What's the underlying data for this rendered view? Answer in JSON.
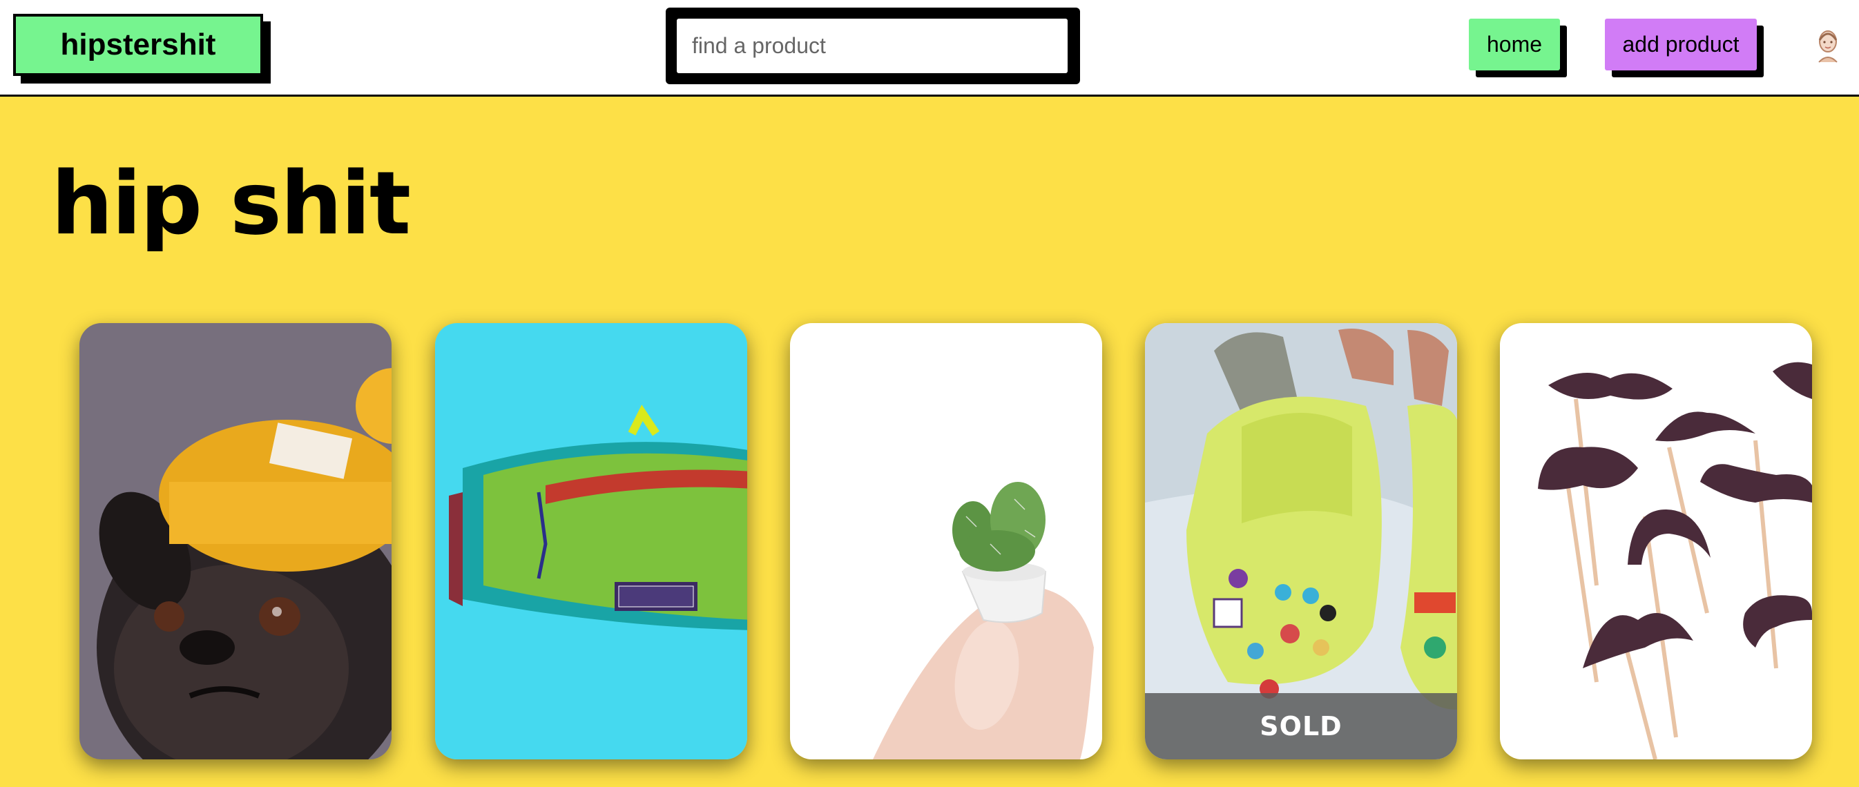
{
  "header": {
    "logo_text": "hipstershit",
    "search": {
      "placeholder": "find a product",
      "value": ""
    },
    "nav": {
      "home_label": "home",
      "add_product_label": "add product"
    },
    "avatar_icon": "user-avatar-icon"
  },
  "main": {
    "title": "hip shit",
    "products": [
      {
        "image": "pug-in-beanie",
        "sold": false
      },
      {
        "image": "patagonia-fanny-pack",
        "sold": false
      },
      {
        "image": "mini-cactus",
        "sold": false
      },
      {
        "image": "crocs-with-charms",
        "sold": true,
        "badge": "SOLD"
      },
      {
        "image": "mustache-props",
        "sold": false
      }
    ]
  },
  "colors": {
    "background": "#fde047",
    "logo_bg": "#76f48f",
    "home_bg": "#76f48f",
    "add_product_bg": "#d17cf6",
    "sold_overlay": "#5a5a5a"
  }
}
